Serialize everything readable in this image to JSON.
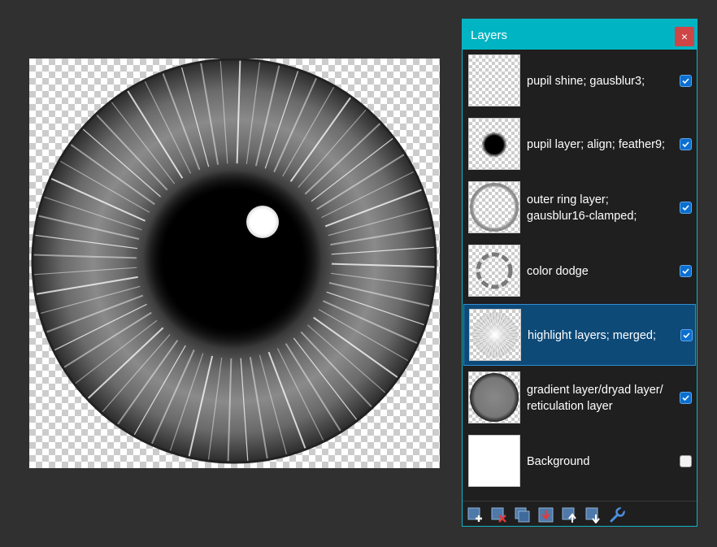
{
  "canvas": {
    "image": "grayscale-eye-iris-on-transparent-background"
  },
  "panel": {
    "title": "Layers",
    "close_label": "×",
    "layers": [
      {
        "name": "pupil shine; gausblur3;",
        "visible": true,
        "selected": false,
        "thumb": "pupil-shine"
      },
      {
        "name": "pupil layer; align; feather9;",
        "visible": true,
        "selected": false,
        "thumb": "pupil"
      },
      {
        "name": "outer ring layer; gausblur16-clamped;",
        "visible": true,
        "selected": false,
        "thumb": "outer-ring"
      },
      {
        "name": "color dodge",
        "visible": true,
        "selected": false,
        "thumb": "color-dodge"
      },
      {
        "name": "highlight layers; merged;",
        "visible": true,
        "selected": true,
        "thumb": "highlight-rays"
      },
      {
        "name": "gradient layer/dryad layer/ reticulation layer",
        "visible": true,
        "selected": false,
        "thumb": "gradient-disc"
      },
      {
        "name": "Background",
        "visible": false,
        "selected": false,
        "thumb": "white"
      }
    ]
  },
  "toolbar": {
    "tools": [
      "add-layer-icon",
      "delete-layer-icon",
      "duplicate-layer-icon",
      "merge-layer-down-icon",
      "move-layer-up-icon",
      "move-layer-down-icon",
      "layer-properties-wrench-icon"
    ]
  }
}
